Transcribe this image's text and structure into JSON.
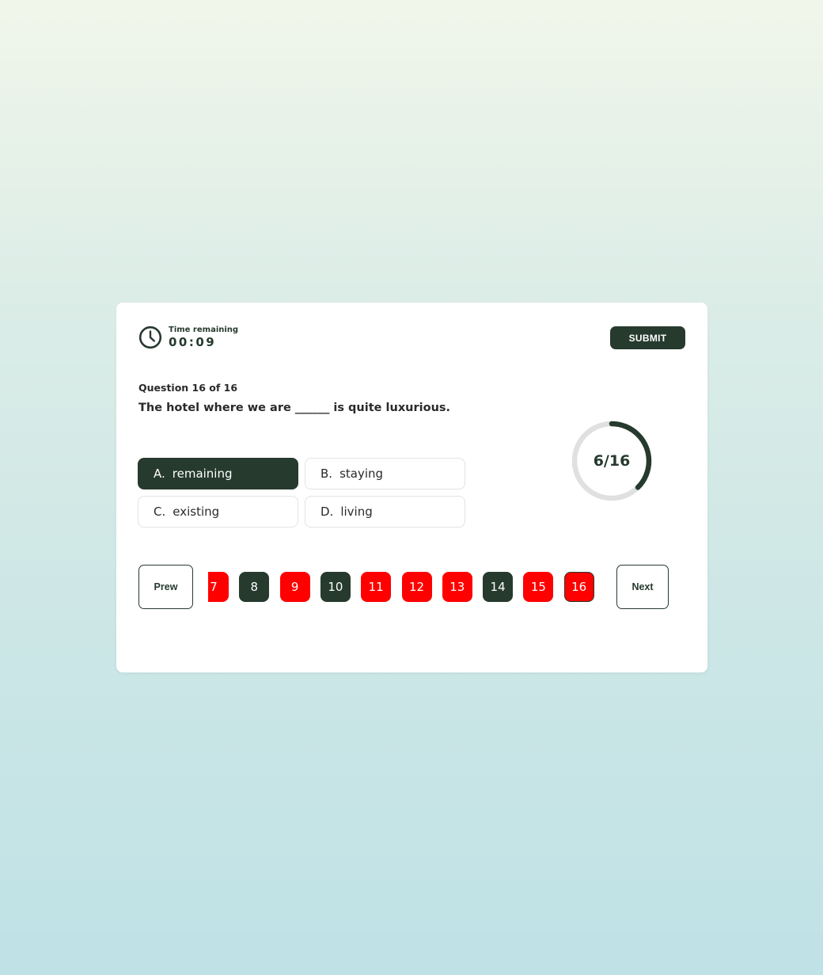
{
  "timer": {
    "label": "Time remaining",
    "value": "00:09",
    "icon": "clock-icon"
  },
  "header": {
    "submit_label": "SUBMIT"
  },
  "question": {
    "number_text": "Question 16 of 16",
    "text": "The hotel where we are ______ is quite luxurious."
  },
  "options": [
    {
      "letter": "A.",
      "text": "remaining",
      "selected": true
    },
    {
      "letter": "B.",
      "text": "staying",
      "selected": false
    },
    {
      "letter": "C.",
      "text": "existing",
      "selected": false
    },
    {
      "letter": "D.",
      "text": "living",
      "selected": false
    }
  ],
  "progress": {
    "text": "6/16",
    "answered": 6,
    "total": 16
  },
  "nav": {
    "prev_label": "Prew",
    "next_label": "Next"
  },
  "pages": [
    {
      "label": "7",
      "status": "unanswered"
    },
    {
      "label": "8",
      "status": "answered"
    },
    {
      "label": "9",
      "status": "unanswered"
    },
    {
      "label": "10",
      "status": "answered"
    },
    {
      "label": "11",
      "status": "unanswered"
    },
    {
      "label": "12",
      "status": "unanswered"
    },
    {
      "label": "13",
      "status": "unanswered"
    },
    {
      "label": "14",
      "status": "answered"
    },
    {
      "label": "15",
      "status": "unanswered"
    },
    {
      "label": "16",
      "status": "unanswered",
      "current": true
    }
  ],
  "colors": {
    "primary": "#263a2e",
    "unanswered": "#ff0000",
    "track": "#e0e0e0"
  }
}
